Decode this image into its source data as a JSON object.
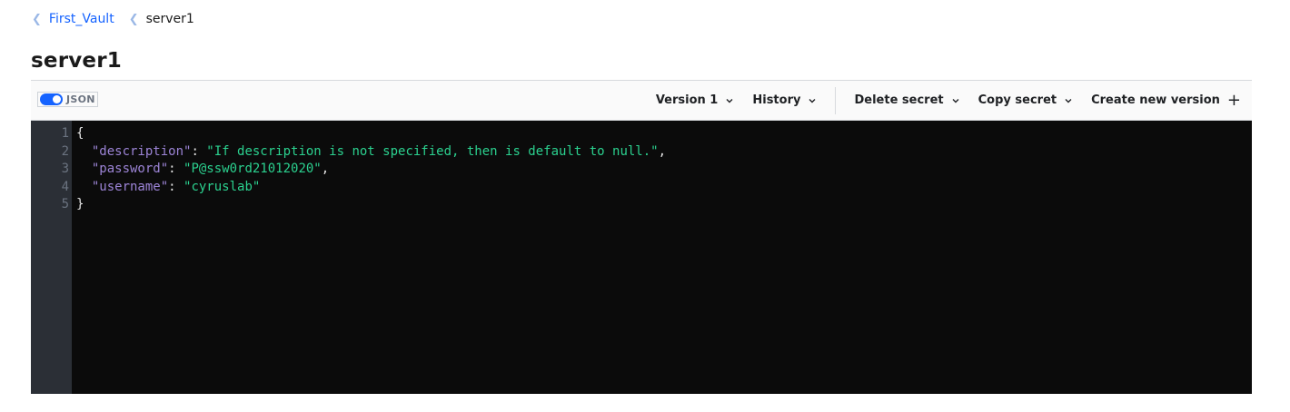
{
  "breadcrumb": {
    "items": [
      {
        "label": "First_Vault"
      },
      {
        "label": "server1"
      }
    ]
  },
  "page": {
    "title": "server1"
  },
  "toolbar": {
    "json_toggle_label": "JSON",
    "json_toggle_on": true,
    "version_label": "Version 1",
    "history_label": "History",
    "delete_label": "Delete secret",
    "copy_label": "Copy secret",
    "create_label": "Create new version",
    "create_icon": "+"
  },
  "editor": {
    "line_numbers": [
      "1",
      "2",
      "3",
      "4",
      "5"
    ],
    "lines": {
      "l1": "{",
      "l2_key": "\"description\"",
      "l2_sep": ": ",
      "l2_val": "\"If description is not specified, then is default to null.\"",
      "l2_end": ",",
      "l3_key": "\"password\"",
      "l3_sep": ": ",
      "l3_val": "\"P@ssw0rd21012020\"",
      "l3_end": ",",
      "l4_key": "\"username\"",
      "l4_sep": ": ",
      "l4_val": "\"cyruslab\"",
      "l5": "}"
    },
    "colors": {
      "key": "#9c84d6",
      "string": "#2bd18f",
      "background": "#0b0b0b",
      "gutter": "#2b2f36"
    }
  },
  "theme": {
    "accent": "#1563ff"
  }
}
